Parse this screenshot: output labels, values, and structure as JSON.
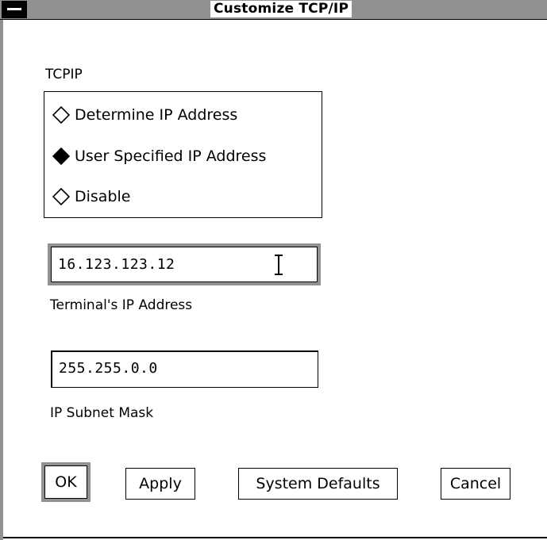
{
  "window": {
    "title": "Customize TCP/IP"
  },
  "group": {
    "label": "TCPIP"
  },
  "radios": [
    {
      "label": "Determine IP Address",
      "selected": false
    },
    {
      "label": "User Specified IP Address",
      "selected": true
    },
    {
      "label": "Disable",
      "selected": false
    }
  ],
  "ip_field": {
    "value": "16.123.123.12",
    "label": "Terminal's IP Address"
  },
  "mask_field": {
    "value": "255.255.0.0",
    "label": "IP Subnet Mask"
  },
  "buttons": {
    "ok": "OK",
    "apply": "Apply",
    "defaults": "System Defaults",
    "cancel": "Cancel"
  }
}
